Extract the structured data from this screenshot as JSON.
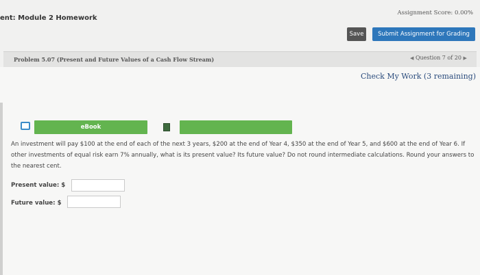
{
  "header": {
    "assignment_title": "ent: Module 2 Homework",
    "score": "Assignment Score: 0.00%",
    "save_label": "Save",
    "submit_label": "Submit Assignment for Grading"
  },
  "problem_bar": {
    "title": "Problem 5.07 (Present and Future Values of a Cash Flow Stream)",
    "question_nav": "Question 7 of 20",
    "prev_icon": "left-triangle",
    "next_icon": "right-triangle"
  },
  "check_work": "Check My Work (3 remaining)",
  "ebook": {
    "label": "eBook",
    "icon": "book-icon",
    "calc_icon": "calculator-icon"
  },
  "problem_text": "An investment will pay $100 at the end of each of the next 3 years, $200 at the end of Year 4, $350 at the end of Year 5, and $600 at the end of Year 6. If other investments of equal risk earn 7% annually, what is its present value? Its future value? Do not round intermediate calculations. Round your answers to the nearest cent.",
  "answers": {
    "present_value_label": "Present value: $",
    "present_value": "",
    "future_value_label": "Future value: $",
    "future_value": ""
  }
}
